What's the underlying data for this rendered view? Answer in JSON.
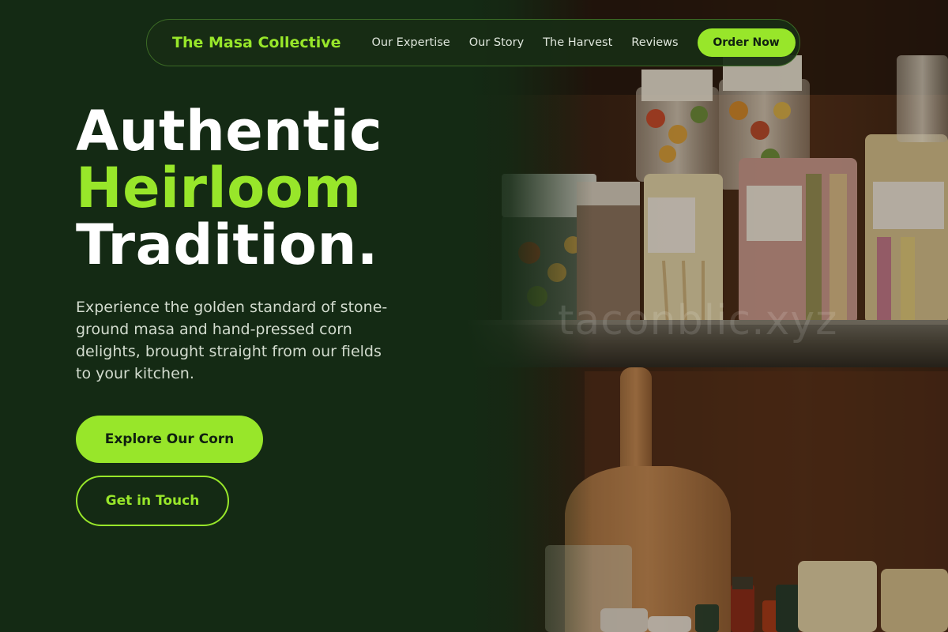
{
  "nav": {
    "brand": "The Masa Collective",
    "links": [
      "Our Expertise",
      "Our Story",
      "The Harvest",
      "Reviews"
    ],
    "cta": "Order Now"
  },
  "hero": {
    "headline_line1": "Authentic",
    "headline_line2": "Heirloom",
    "headline_line3": "Tradition.",
    "description": "Experience the golden standard of stone-ground masa and hand-pressed corn delights, brought straight from our fields to your kitchen.",
    "primary_button": "Explore Our Corn",
    "secondary_button": "Get in Touch"
  },
  "image": {
    "watermark": "taconblic.xyz"
  },
  "colors": {
    "background": "#142a14",
    "accent": "#98e62a",
    "text_primary": "#ffffff",
    "text_secondary": "#d3dccf"
  }
}
